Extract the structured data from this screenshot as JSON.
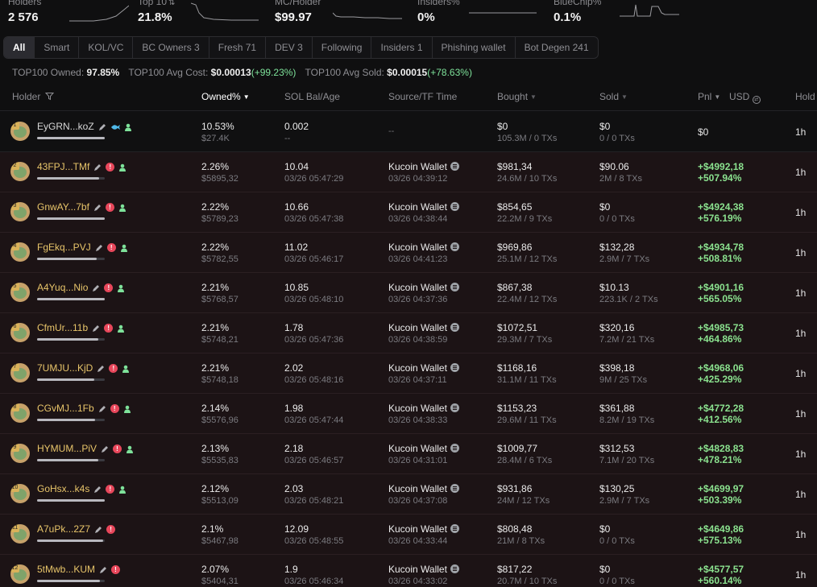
{
  "stats": [
    {
      "label": "Holders",
      "value": "2 576"
    },
    {
      "label": "Top 10",
      "value": "21.8%",
      "sort_icon": "sort-arrows-icon"
    },
    {
      "label": "MC/Holder",
      "value": "$99.97"
    },
    {
      "label": "Insiders%",
      "value": "0%"
    },
    {
      "label": "BlueChip%",
      "value": "0.1%"
    }
  ],
  "tabs": [
    "All",
    "Smart",
    "KOL/VC",
    "BC Owners 3",
    "Fresh 71",
    "DEV 3",
    "Following",
    "Insiders 1",
    "Phishing wallet",
    "Bot Degen 241"
  ],
  "active_tab": "All",
  "summary": {
    "owned_label": "TOP100 Owned:",
    "owned_value": "97.85%",
    "avg_cost_label": "TOP100 Avg Cost:",
    "avg_cost_value": "$0.00013",
    "avg_cost_change": "(+99.23%)",
    "avg_sold_label": "TOP100 Avg Sold:",
    "avg_sold_value": "$0.00015",
    "avg_sold_change": "(+78.63%)"
  },
  "columns": {
    "holder": "Holder",
    "owned": "Owned%",
    "sol_bal": "SOL Bal/Age",
    "source": "Source/TF Time",
    "bought": "Bought",
    "sold": "Sold",
    "pnl": "Pnl",
    "currency": "USD",
    "hold": "Hold"
  },
  "colors": {
    "accent_positive": "#8be28f",
    "alert": "#e8475b",
    "holder_name": "#e8c56a"
  },
  "rows": [
    {
      "rank": "1",
      "name": "EyGRN...koZ",
      "bar": 1.0,
      "owned_pct": "10.53%",
      "owned_usd": "$27.4K",
      "sol": "0.002",
      "age": "--",
      "source": "--",
      "time": "",
      "bought": "$0",
      "bought_sub": "105.3M / 0 TXs",
      "sold": "$0",
      "sold_sub": "0 / 0 TXs",
      "pnl": "$0",
      "pnl_pct": "",
      "hold": "1h",
      "icons": [
        "edit-icon",
        "fish-icon",
        "user-icon"
      ]
    },
    {
      "rank": "2",
      "name": "43FPJ...TMf",
      "bar": 0.92,
      "owned_pct": "2.26%",
      "owned_usd": "$5895,32",
      "sol": "10.04",
      "age": "03/26 05:47:29",
      "source": "Kucoin Wallet",
      "time": "03/26 04:39:12",
      "bought": "$981,34",
      "bought_sub": "24.6M / 10 TXs",
      "sold": "$90.06",
      "sold_sub": "2M / 8 TXs",
      "pnl": "+$4992,18",
      "pnl_pct": "+507.94%",
      "hold": "1h",
      "icons": [
        "edit-icon",
        "alert-icon",
        "user-icon"
      ]
    },
    {
      "rank": "3",
      "name": "GnwAY...7bf",
      "bar": 1.0,
      "owned_pct": "2.22%",
      "owned_usd": "$5789,23",
      "sol": "10.66",
      "age": "03/26 05:47:38",
      "source": "Kucoin Wallet",
      "time": "03/26 04:38:44",
      "bought": "$854,65",
      "bought_sub": "22.2M / 9 TXs",
      "sold": "$0",
      "sold_sub": "0 / 0 TXs",
      "pnl": "+$4924,38",
      "pnl_pct": "+576.19%",
      "hold": "1h",
      "icons": [
        "edit-icon",
        "alert-icon",
        "user-icon"
      ]
    },
    {
      "rank": "4",
      "name": "FgEkq...PVJ",
      "bar": 0.88,
      "owned_pct": "2.22%",
      "owned_usd": "$5782,55",
      "sol": "11.02",
      "age": "03/26 05:46:17",
      "source": "Kucoin Wallet",
      "time": "03/26 04:41:23",
      "bought": "$969,86",
      "bought_sub": "25.1M / 12 TXs",
      "sold": "$132,28",
      "sold_sub": "2.9M / 7 TXs",
      "pnl": "+$4934,78",
      "pnl_pct": "+508.81%",
      "hold": "1h",
      "icons": [
        "edit-icon",
        "alert-icon",
        "user-icon"
      ]
    },
    {
      "rank": "5",
      "name": "A4Yuq...Nio",
      "bar": 1.0,
      "owned_pct": "2.21%",
      "owned_usd": "$5768,57",
      "sol": "10.85",
      "age": "03/26 05:48:10",
      "source": "Kucoin Wallet",
      "time": "03/26 04:37:36",
      "bought": "$867,38",
      "bought_sub": "22.4M / 12 TXs",
      "sold": "$10.13",
      "sold_sub": "223.1K / 2 TXs",
      "pnl": "+$4901,16",
      "pnl_pct": "+565.05%",
      "hold": "1h",
      "icons": [
        "edit-icon",
        "alert-icon",
        "user-icon"
      ]
    },
    {
      "rank": "6",
      "name": "CfmUr...11b",
      "bar": 0.9,
      "owned_pct": "2.21%",
      "owned_usd": "$5748,21",
      "sol": "1.78",
      "age": "03/26 05:47:36",
      "source": "Kucoin Wallet",
      "time": "03/26 04:38:59",
      "bought": "$1072,51",
      "bought_sub": "29.3M / 7 TXs",
      "sold": "$320,16",
      "sold_sub": "7.2M / 21 TXs",
      "pnl": "+$4985,73",
      "pnl_pct": "+464.86%",
      "hold": "1h",
      "icons": [
        "edit-icon",
        "alert-icon",
        "user-icon"
      ]
    },
    {
      "rank": "7",
      "name": "7UMJU...KjD",
      "bar": 0.85,
      "owned_pct": "2.21%",
      "owned_usd": "$5748,18",
      "sol": "2.02",
      "age": "03/26 05:48:16",
      "source": "Kucoin Wallet",
      "time": "03/26 04:37:11",
      "bought": "$1168,16",
      "bought_sub": "31.1M / 11 TXs",
      "sold": "$398,18",
      "sold_sub": "9M / 25 TXs",
      "pnl": "+$4968,06",
      "pnl_pct": "+425.29%",
      "hold": "1h",
      "icons": [
        "edit-icon",
        "alert-icon",
        "user-icon"
      ]
    },
    {
      "rank": "8",
      "name": "CGvMJ...1Fb",
      "bar": 0.86,
      "owned_pct": "2.14%",
      "owned_usd": "$5576,96",
      "sol": "1.98",
      "age": "03/26 05:47:44",
      "source": "Kucoin Wallet",
      "time": "03/26 04:38:33",
      "bought": "$1153,23",
      "bought_sub": "29.6M / 11 TXs",
      "sold": "$361,88",
      "sold_sub": "8.2M / 19 TXs",
      "pnl": "+$4772,28",
      "pnl_pct": "+412.56%",
      "hold": "1h",
      "icons": [
        "edit-icon",
        "alert-icon",
        "user-icon"
      ]
    },
    {
      "rank": "9",
      "name": "HYMUM...PiV",
      "bar": 0.9,
      "owned_pct": "2.13%",
      "owned_usd": "$5535,83",
      "sol": "2.18",
      "age": "03/26 05:46:57",
      "source": "Kucoin Wallet",
      "time": "03/26 04:31:01",
      "bought": "$1009,77",
      "bought_sub": "28.4M / 6 TXs",
      "sold": "$312,53",
      "sold_sub": "7.1M / 20 TXs",
      "pnl": "+$4828,83",
      "pnl_pct": "+478.21%",
      "hold": "1h",
      "icons": [
        "edit-icon",
        "alert-icon",
        "user-icon"
      ]
    },
    {
      "rank": "10",
      "name": "GoHsx...k4s",
      "bar": 1.0,
      "owned_pct": "2.12%",
      "owned_usd": "$5513,09",
      "sol": "2.03",
      "age": "03/26 05:48:21",
      "source": "Kucoin Wallet",
      "time": "03/26 04:37:08",
      "bought": "$931,86",
      "bought_sub": "24M / 12 TXs",
      "sold": "$130,25",
      "sold_sub": "2.9M / 7 TXs",
      "pnl": "+$4699,97",
      "pnl_pct": "+503.39%",
      "hold": "1h",
      "icons": [
        "edit-icon",
        "alert-icon",
        "user-icon"
      ]
    },
    {
      "rank": "11",
      "name": "A7uPk...2Z7",
      "bar": 0.98,
      "owned_pct": "2.1%",
      "owned_usd": "$5467,98",
      "sol": "12.09",
      "age": "03/26 05:48:55",
      "source": "Kucoin Wallet",
      "time": "03/26 04:33:44",
      "bought": "$808,48",
      "bought_sub": "21M / 8 TXs",
      "sold": "$0",
      "sold_sub": "0 / 0 TXs",
      "pnl": "+$4649,86",
      "pnl_pct": "+575.13%",
      "hold": "1h",
      "icons": [
        "edit-icon",
        "alert-icon"
      ]
    },
    {
      "rank": "12",
      "name": "5tMwb...KUM",
      "bar": 0.93,
      "owned_pct": "2.07%",
      "owned_usd": "$5404,31",
      "sol": "1.9",
      "age": "03/26 05:46:34",
      "source": "Kucoin Wallet",
      "time": "03/26 04:33:02",
      "bought": "$817,22",
      "bought_sub": "20.7M / 10 TXs",
      "sold": "$0",
      "sold_sub": "0 / 0 TXs",
      "pnl": "+$4577,57",
      "pnl_pct": "+560.14%",
      "hold": "1h",
      "icons": [
        "edit-icon",
        "alert-icon"
      ]
    }
  ]
}
